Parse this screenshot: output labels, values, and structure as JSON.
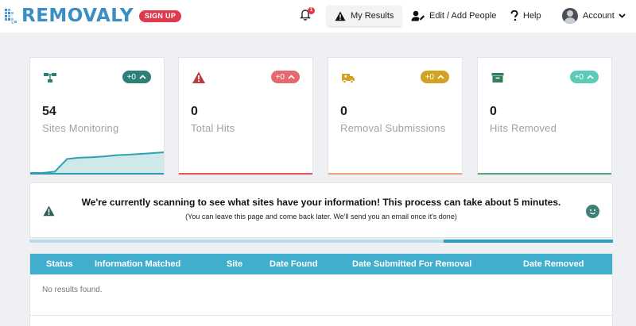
{
  "header": {
    "logo_text": "REMOVALY",
    "signup_label": "SIGN UP",
    "notifications_count": "1",
    "nav": {
      "results": "My Results",
      "edit_people": "Edit / Add People",
      "help": "Help",
      "account": "Account"
    }
  },
  "cards": [
    {
      "value": "54",
      "label": "Sites Monitoring",
      "delta": "+0",
      "accent": "#2f7f79"
    },
    {
      "value": "0",
      "label": "Total Hits",
      "delta": "+0",
      "accent": "#e56a6f"
    },
    {
      "value": "0",
      "label": "Removal Submissions",
      "delta": "+0",
      "accent": "#d3a123"
    },
    {
      "value": "0",
      "label": "Hits Removed",
      "delta": "+0",
      "accent": "#5bcbb8"
    }
  ],
  "sparkline": [
    0,
    0,
    0.05,
    0.55,
    0.6,
    0.62,
    0.65,
    0.7,
    0.72,
    0.75,
    0.78,
    0.82
  ],
  "notice": {
    "message": "We're currently scanning to see what sites have your information! This process can take about 5 minutes.",
    "sub": "(You can leave this page and come back later. We'll send you an email once it's done)"
  },
  "progress": 0.71,
  "table": {
    "columns": [
      "Status",
      "Information Matched",
      "Site",
      "Date Found",
      "Date Submitted For Removal",
      "Date Removed"
    ],
    "empty_text": "No results found."
  },
  "colors": {
    "brand": "#3a8fc2",
    "signup": "#e0394b",
    "table_header": "#41aecd"
  }
}
